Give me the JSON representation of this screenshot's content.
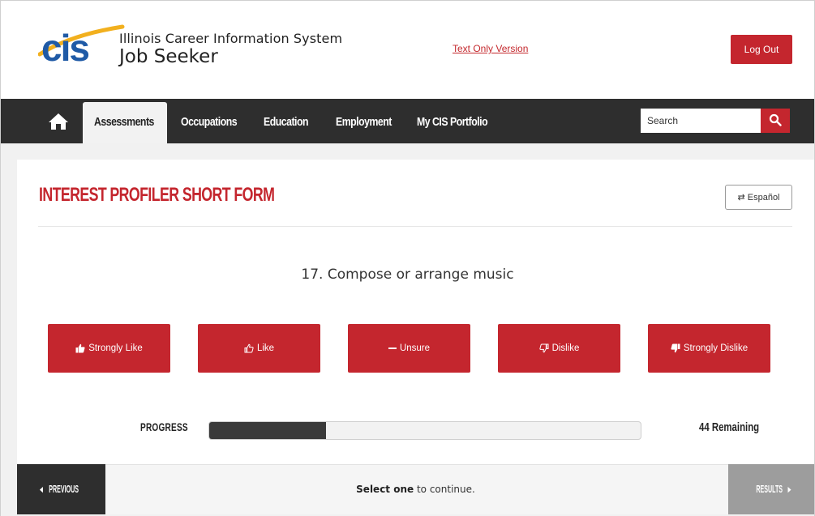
{
  "header": {
    "logo_text": "cis",
    "system_name": "Illinois Career Information System",
    "subtitle": "Job Seeker",
    "text_only_link": "Text Only Version",
    "logout_label": "Log Out"
  },
  "nav": {
    "home_icon": "home-icon",
    "items": [
      {
        "label": "Assessments",
        "active": true
      },
      {
        "label": "Occupations",
        "active": false
      },
      {
        "label": "Education",
        "active": false
      },
      {
        "label": "Employment",
        "active": false
      },
      {
        "label": "My CIS Portfolio",
        "active": false
      }
    ],
    "search_placeholder": "Search",
    "search_icon": "search-icon"
  },
  "main": {
    "title": "INTEREST PROFILER SHORT FORM",
    "language_button": "Español",
    "question": "17. Compose or arrange music",
    "answers": [
      {
        "label": "Strongly Like",
        "icon": "thumbs-up-filled-icon"
      },
      {
        "label": "Like",
        "icon": "thumbs-up-outline-icon"
      },
      {
        "label": "Unsure",
        "icon": "minus-icon"
      },
      {
        "label": "Dislike",
        "icon": "thumbs-down-outline-icon"
      },
      {
        "label": "Strongly Dislike",
        "icon": "thumbs-down-filled-icon"
      }
    ],
    "progress": {
      "label": "PROGRESS",
      "fraction": 0.27,
      "remaining_text": "44 Remaining"
    }
  },
  "footer": {
    "previous_label": "PREVIOUS",
    "select_bold": "Select one",
    "select_rest": " to continue.",
    "results_label": "RESULTS"
  },
  "colors": {
    "brand_red": "#c4262e",
    "nav_dark": "#2e2e2e",
    "logo_blue": "#1f5aa6",
    "logo_yellow": "#f2b01e"
  }
}
